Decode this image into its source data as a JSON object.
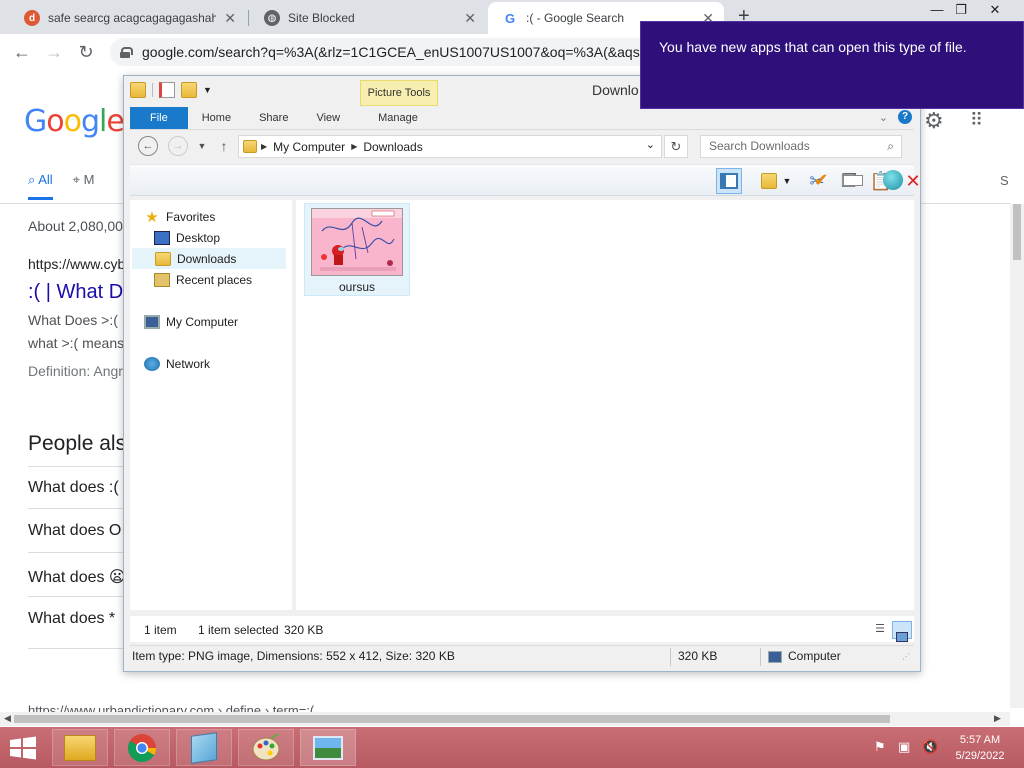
{
  "browser": {
    "tabs": [
      {
        "title": "safe searcg acagcagagagashahal",
        "icon": "duckduckgo-icon",
        "active": false
      },
      {
        "title": "Site Blocked",
        "icon": "globe-icon",
        "active": false
      },
      {
        "title": ":( - Google Search",
        "icon": "google-icon",
        "active": true
      }
    ],
    "url": "google.com/search?q=%3A(&rlz=1C1GCEA_enUS1007US1007&oq=%3A(&aqs=c"
  },
  "google": {
    "logo": "Google",
    "tabs": [
      "All",
      "M"
    ],
    "right_tab": "S",
    "result_count": "About 2,080,00",
    "result1_url": "https://www.cyb",
    "result1_title": ":( | What D",
    "result1_snippet1": "What Does >:(",
    "result1_snippet2": "what >:( means",
    "result1_snippet3": "Definition: Angr",
    "paa_heading": "People als",
    "paa_questions": [
      "What does :(",
      "What does O",
      "What does 😦",
      "What does *"
    ],
    "bottom_url": "https://www.urbandictionary.com › define › term=:("
  },
  "explorer": {
    "title": "Downlo",
    "picture_tools": "Picture Tools",
    "ribbon_tabs": [
      "File",
      "Home",
      "Share",
      "View",
      "Manage"
    ],
    "address": [
      "My Computer",
      "Downloads"
    ],
    "search_placeholder": "Search Downloads",
    "nav": {
      "favorites": "Favorites",
      "desktop": "Desktop",
      "downloads": "Downloads",
      "recent": "Recent places",
      "computer": "My Computer",
      "network": "Network"
    },
    "file": {
      "name": "oursus"
    },
    "status": {
      "count": "1 item",
      "selected": "1 item selected",
      "size": "320 KB",
      "details": "Item type: PNG image, Dimensions: 552 x 412, Size: 320 KB",
      "details_size": "320 KB",
      "location": "Computer"
    }
  },
  "toast": {
    "message": "You have new apps that can open this type of file."
  },
  "taskbar": {
    "time": "5:57 AM",
    "date": "5/29/2022"
  }
}
